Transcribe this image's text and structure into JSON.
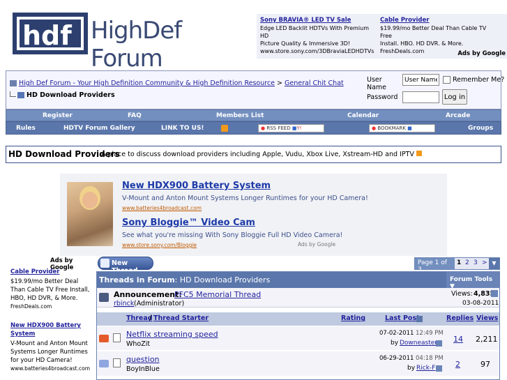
{
  "header": {
    "logo_text": "HighDef Forum",
    "ads": [
      {
        "title": "Sony BRAVIA® LED TV Sale",
        "lines": [
          "Edge LED Backlit HDTVs With Premium HD",
          "Picture Quality & Immersive 3D!"
        ],
        "url": "www.store.sony.com/3DBraviaLEDHDTVs"
      },
      {
        "title": "Cable Provider",
        "lines": [
          "$19.99/mo Better Deal Than Cable TV Free",
          "Install. HBO. HD DVR. & More."
        ],
        "url": "FreshDeals.com"
      }
    ],
    "ads_by_google": "Ads by Google"
  },
  "breadcrumb": {
    "root": "High Def Forum - Your High Definition Community & High Definition Resource",
    "sep": ">",
    "parent": "General Chit Chat",
    "current": "HD Download Providers"
  },
  "login": {
    "user_label": "User Name",
    "user_placeholder": "User Name",
    "remember": "Remember Me?",
    "pass_label": "Password",
    "button": "Log in"
  },
  "nav1": [
    "Register",
    "FAQ",
    "Members List",
    "Calendar",
    "Arcade"
  ],
  "nav2": {
    "rules": "Rules",
    "gallery": "HDTV Forum Gallery",
    "link": "LINK TO US!",
    "rss": "RSS FEED",
    "bookmark": "BOOKMARK",
    "groups": "Groups"
  },
  "forum": {
    "title": "HD Download Providers",
    "desc": "A place to discuss download providers including Apple, Vudu, Xbox Live, Xstream-HD and IPTV"
  },
  "adblock": {
    "ads": [
      {
        "title": "New HDX900 Battery System",
        "text": "V-Mount and Anton Mount Systems Longer Runtimes for your HD Camera!",
        "url": "www.batteries4broadcast.com"
      },
      {
        "title": "Sony Bloggie™ Video Cam",
        "text": "See what you're missing With Sony Bloggie Full HD Video Camera!",
        "url": "www.store.sony.com/Bloggie"
      }
    ],
    "ads_by_google": "Ads by Google"
  },
  "sidebar": {
    "ads_by_google": "Ads by Google",
    "ads": [
      {
        "title": "Cable Provider",
        "text": "$19.99/mo Better Deal Than Cable TV Free Install, HBO, HD DVR, & More.",
        "url": "FreshDeals.com"
      },
      {
        "title": "New HDX900 Battery System",
        "text": "V-Mount and Anton Mount Systems Longer Runtimes for your HD Camera!",
        "url": "www.batteries4broadcast.com"
      }
    ]
  },
  "threads": {
    "new_thread": "New Thread",
    "pager": {
      "label": "Page 1 of 3",
      "pages": [
        "1",
        "2",
        "3"
      ],
      "next": ">"
    },
    "header_title": "Threads in Forum",
    "header_forum": ": HD Download Providers",
    "tools": "Forum Tools",
    "announcement": {
      "label": "Announcement:",
      "title": "PFC5 Memorial Thread",
      "author": "rbinck",
      "role": "(Administrator)",
      "views_label": "Views:",
      "views": "4,835",
      "date": "03-08-2011"
    },
    "columns": {
      "thread": "Thread",
      "starter": "Thread Starter",
      "rating": "Rating",
      "lastpost": "Last Post",
      "replies": "Replies",
      "views": "Views"
    },
    "rows": [
      {
        "title": "Netflix streaming speed",
        "starter": "WhoZit",
        "date": "07-02-2011",
        "time": "12:49 PM",
        "by": "by",
        "last_user": "Downeaster",
        "replies": "14",
        "views": "2,211"
      },
      {
        "title": "question",
        "starter": "BoyInBlue",
        "date": "06-29-2011",
        "time": "04:18 PM",
        "by": "by",
        "last_user": "Rick-F",
        "replies": "2",
        "views": "97"
      }
    ]
  }
}
